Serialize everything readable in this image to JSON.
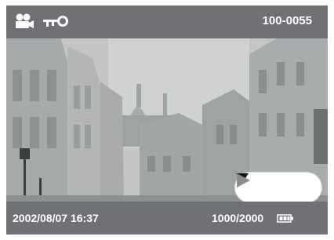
{
  "status": {
    "file_number": "100-0055",
    "datetime": "2002/08/07 16:37",
    "counter": "1000/2000"
  },
  "icons": {
    "mode": "movie-camera-icon",
    "protect": "key-icon",
    "battery": "battery-icon",
    "nav_down": "triangle-down-icon",
    "nav_right": "triangle-right-icon"
  },
  "colors": {
    "frame": "#6f7174",
    "text": "#ffffff",
    "nav_down_arrow": "#111111",
    "nav_right_arrow": "#8a8c8e"
  },
  "photo": {
    "subject": "street-with-buildings-and-domed-church"
  }
}
